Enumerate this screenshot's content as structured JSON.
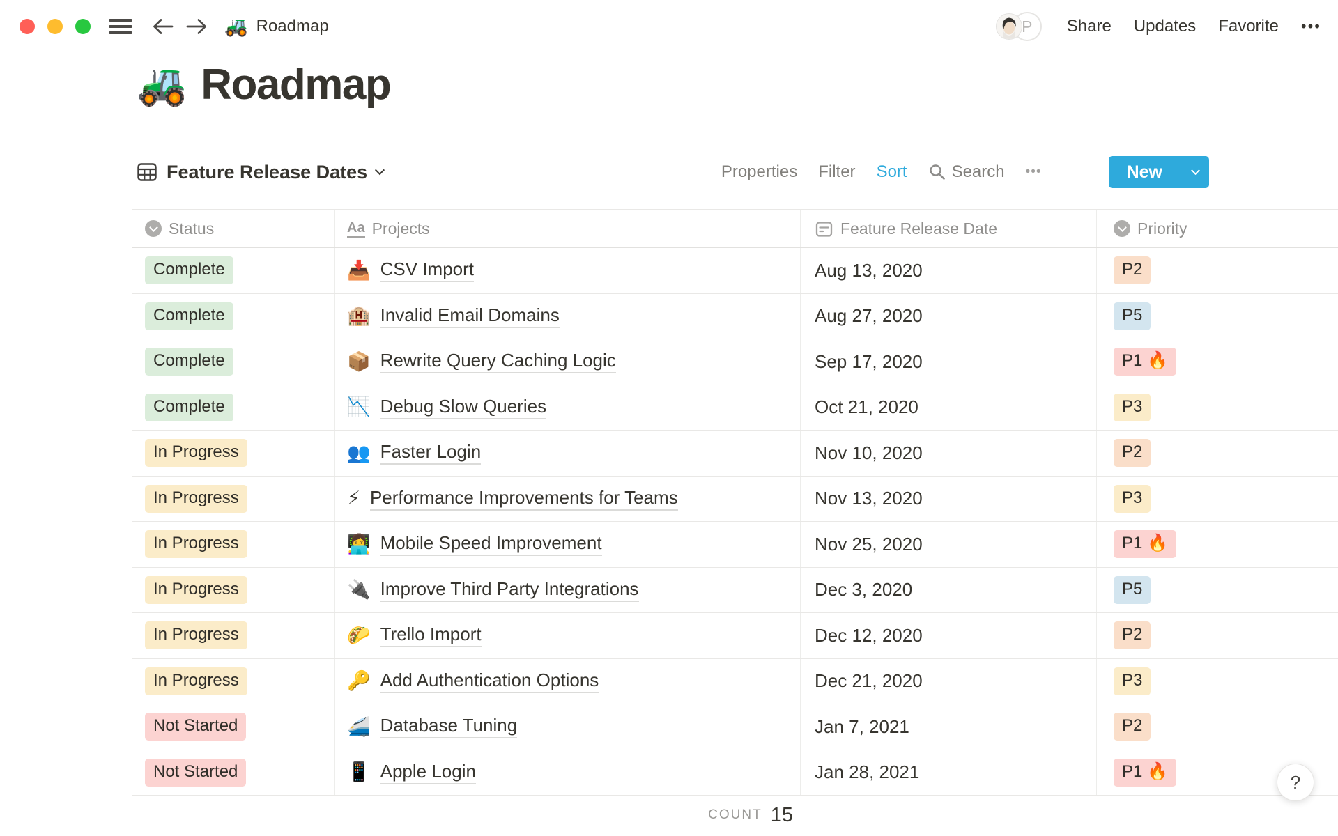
{
  "topbar": {
    "traffic_lights": {
      "close": "#FF5F57",
      "minimize": "#FEBC2E",
      "maximize": "#28C840"
    },
    "breadcrumb": {
      "emoji": "🚜",
      "label": "Roadmap"
    },
    "avatar_initial": "P",
    "share_label": "Share",
    "updates_label": "Updates",
    "favorite_label": "Favorite",
    "more_label": "•••"
  },
  "page": {
    "emoji": "🚜",
    "title": "Roadmap"
  },
  "view_bar": {
    "view_name": "Feature Release Dates",
    "properties_label": "Properties",
    "filter_label": "Filter",
    "sort_label": "Sort",
    "search_label": "Search",
    "more_label": "•••",
    "new_label": "New"
  },
  "table": {
    "columns": [
      {
        "label": "Status",
        "type": "select"
      },
      {
        "label": "Projects",
        "type": "title"
      },
      {
        "label": "Feature Release Date",
        "type": "date"
      },
      {
        "label": "Priority",
        "type": "select"
      }
    ],
    "rows": [
      {
        "status": "Complete",
        "status_color": "green",
        "emoji": "📥",
        "project": "CSV Import",
        "date": "Aug 13, 2020",
        "priority": "P2",
        "priority_color": "orange"
      },
      {
        "status": "Complete",
        "status_color": "green",
        "emoji": "🏨",
        "project": "Invalid Email Domains",
        "date": "Aug 27, 2020",
        "priority": "P5",
        "priority_color": "blue"
      },
      {
        "status": "Complete",
        "status_color": "green",
        "emoji": "📦",
        "project": "Rewrite Query Caching Logic",
        "date": "Sep 17, 2020",
        "priority": "P1 🔥",
        "priority_color": "red"
      },
      {
        "status": "Complete",
        "status_color": "green",
        "emoji": "📉",
        "project": "Debug Slow Queries",
        "date": "Oct 21, 2020",
        "priority": "P3",
        "priority_color": "yellow"
      },
      {
        "status": "In Progress",
        "status_color": "yellow",
        "emoji": "👥",
        "project": "Faster Login",
        "date": "Nov 10, 2020",
        "priority": "P2",
        "priority_color": "orange"
      },
      {
        "status": "In Progress",
        "status_color": "yellow",
        "emoji": "⚡",
        "project": "Performance Improvements for Teams",
        "date": "Nov 13, 2020",
        "priority": "P3",
        "priority_color": "yellow"
      },
      {
        "status": "In Progress",
        "status_color": "yellow",
        "emoji": "👩‍💻",
        "project": "Mobile Speed Improvement",
        "date": "Nov 25, 2020",
        "priority": "P1 🔥",
        "priority_color": "red"
      },
      {
        "status": "In Progress",
        "status_color": "yellow",
        "emoji": "🔌",
        "project": "Improve Third Party Integrations",
        "date": "Dec 3, 2020",
        "priority": "P5",
        "priority_color": "blue"
      },
      {
        "status": "In Progress",
        "status_color": "yellow",
        "emoji": "🌮",
        "project": "Trello Import",
        "date": "Dec 12, 2020",
        "priority": "P2",
        "priority_color": "orange"
      },
      {
        "status": "In Progress",
        "status_color": "yellow",
        "emoji": "🔑",
        "project": "Add Authentication Options",
        "date": "Dec 21, 2020",
        "priority": "P3",
        "priority_color": "yellow"
      },
      {
        "status": "Not Started",
        "status_color": "red",
        "emoji": "🚄",
        "project": "Database Tuning",
        "date": "Jan 7, 2021",
        "priority": "P2",
        "priority_color": "orange"
      },
      {
        "status": "Not Started",
        "status_color": "red",
        "emoji": "📱",
        "project": "Apple Login",
        "date": "Jan 28, 2021",
        "priority": "P1 🔥",
        "priority_color": "red"
      }
    ],
    "footer": {
      "count_label": "COUNT",
      "count_value": "15"
    }
  },
  "help_button_label": "?",
  "colors": {
    "accent_blue": "#2EAADC",
    "status_complete_bg": "#DBEDDB",
    "status_in_progress_bg": "#FBECC9",
    "status_not_started_bg": "#FCD3D1",
    "priority_orange_bg": "#FADEC9",
    "priority_blue_bg": "#D3E5EF",
    "priority_red_bg": "#FCD3D1",
    "priority_yellow_bg": "#FBECC9",
    "text_dark": "#37352F",
    "text_gray": "#8F8E8C",
    "border": "#E9E8E6"
  }
}
